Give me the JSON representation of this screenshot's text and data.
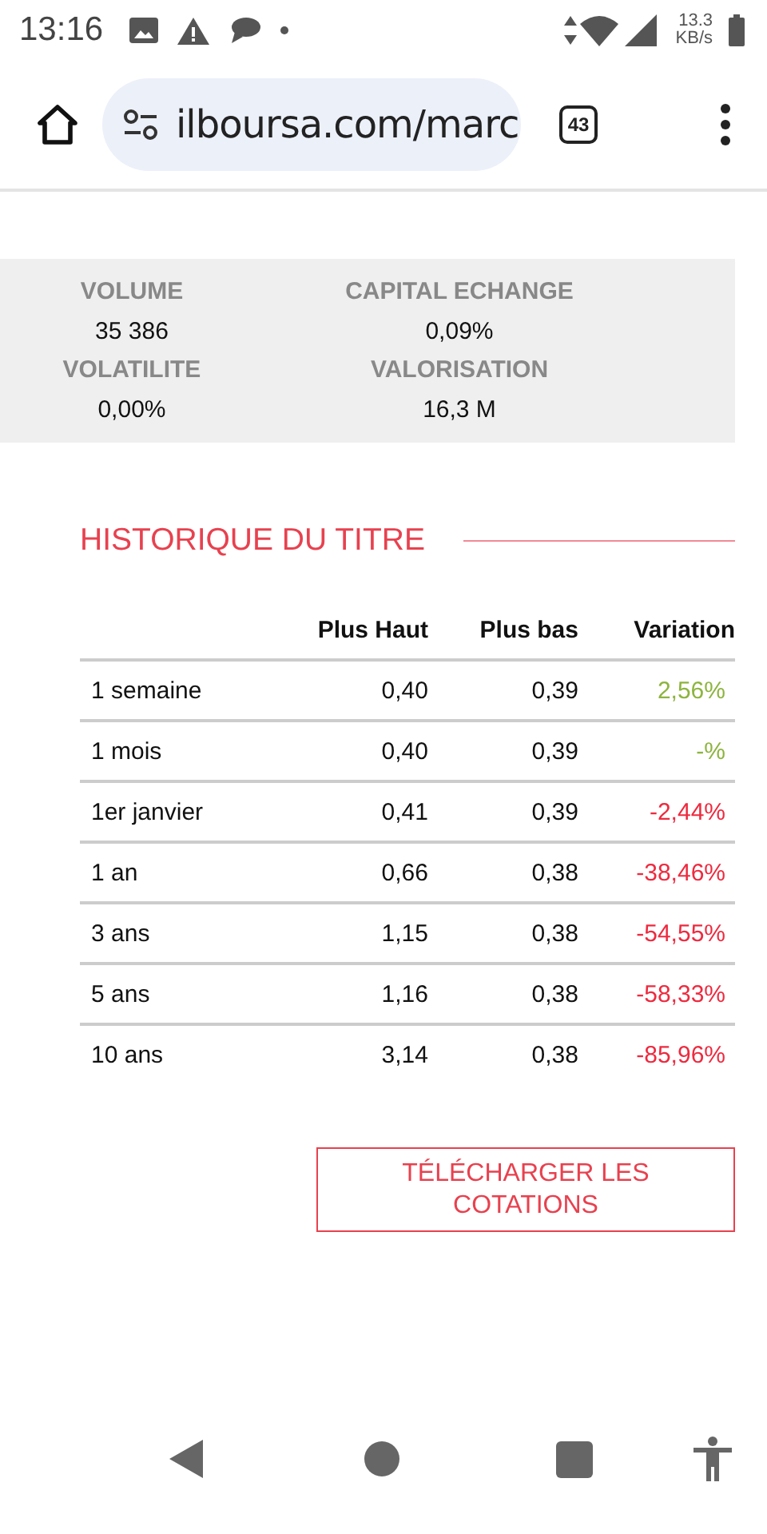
{
  "status_bar": {
    "time": "13:16",
    "speed_value": "13.3",
    "speed_unit": "KB/s"
  },
  "browser": {
    "url": "ilboursa.com/marc",
    "tab_count": "43"
  },
  "stats": [
    {
      "label": "VOLUME",
      "value": "35 386"
    },
    {
      "label": "CAPITAL ECHANGE",
      "value": "0,09%"
    },
    {
      "label": "VOLATILITE",
      "value": "0,00%"
    },
    {
      "label": "VALORISATION",
      "value": "16,3 M"
    }
  ],
  "history": {
    "title": "HISTORIQUE DU TITRE",
    "columns": [
      "Plus Haut",
      "Plus bas",
      "Variation"
    ],
    "rows": [
      {
        "period": "1 semaine",
        "high": "0,40",
        "low": "0,39",
        "variation": "2,56%",
        "color": "#8db43e"
      },
      {
        "period": "1 mois",
        "high": "0,40",
        "low": "0,39",
        "variation": "-%",
        "color": "#8db43e"
      },
      {
        "period": "1er janvier",
        "high": "0,41",
        "low": "0,39",
        "variation": "-2,44%",
        "color": "#ee2a3f"
      },
      {
        "period": "1 an",
        "high": "0,66",
        "low": "0,38",
        "variation": "-38,46%",
        "color": "#ee2a3f"
      },
      {
        "period": "3 ans",
        "high": "1,15",
        "low": "0,38",
        "variation": "-54,55%",
        "color": "#ee2a3f"
      },
      {
        "period": "5 ans",
        "high": "1,16",
        "low": "0,38",
        "variation": "-58,33%",
        "color": "#ee2a3f"
      },
      {
        "period": "10 ans",
        "high": "3,14",
        "low": "0,38",
        "variation": "-85,96%",
        "color": "#ee2a3f"
      }
    ],
    "download_button": "TÉLÉCHARGER LES COTATIONS"
  }
}
